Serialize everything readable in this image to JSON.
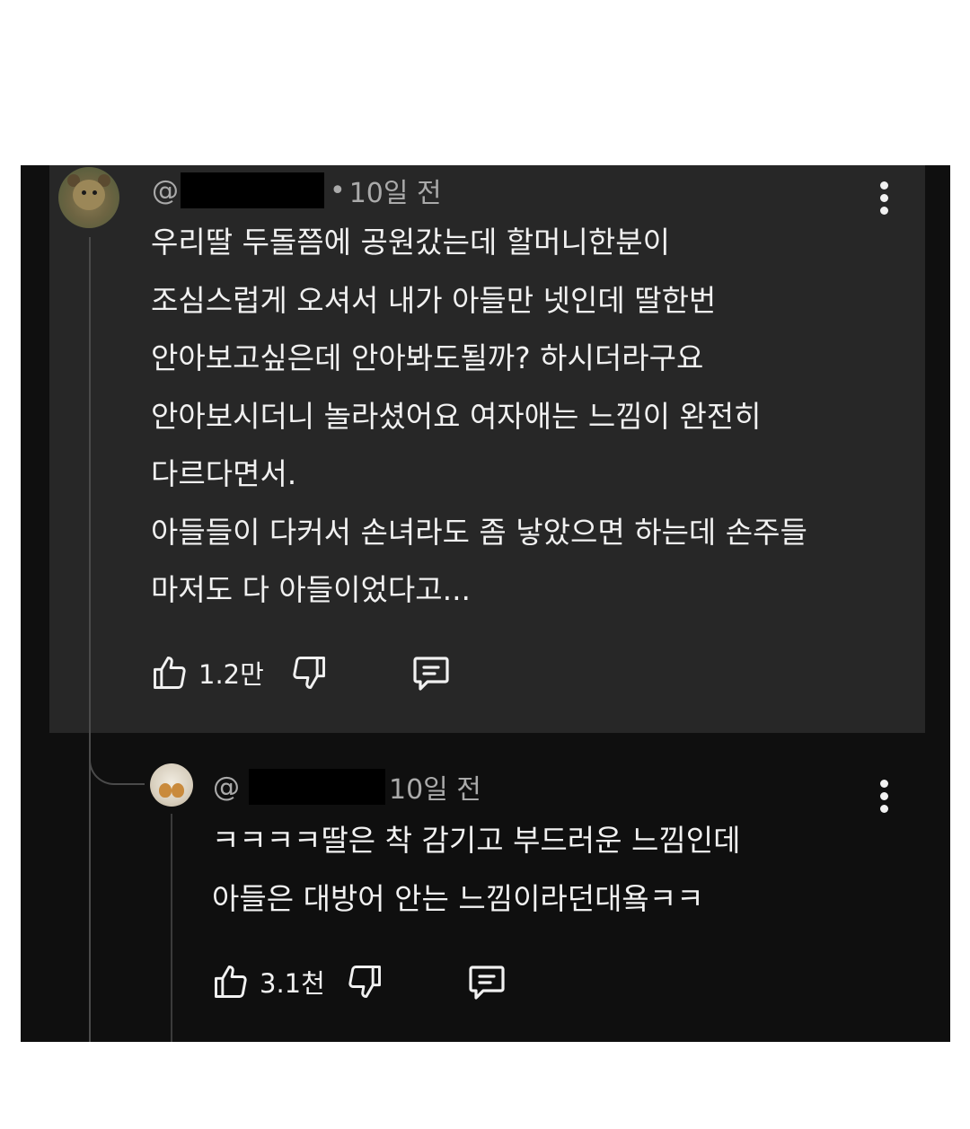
{
  "comments": [
    {
      "handle_prefix": "@",
      "time": "10일 전",
      "text": "우리딸 두돌쯤에 공원갔는데 할머니한분이\n조심스럽게 오셔서 내가 아들만 넷인데 딸한번\n안아보고싶은데 안아봐도될까? 하시더라구요\n안아보시더니 놀라셨어요 여자애는 느낌이 완전히\n다르다면서.\n아들들이 다커서 손녀라도 좀 낳았으면 하는데 손주들\n마저도 다 아들이었다고...",
      "likes": "1.2만",
      "icons": {
        "like": "thumbs-up-icon",
        "dislike": "thumbs-down-icon",
        "reply": "reply-comment-icon",
        "menu": "more-vert-icon"
      }
    },
    {
      "handle_prefix": "@",
      "time": "10일 전",
      "text": "ㅋㅋㅋㅋ딸은 착 감기고 부드러운 느낌인데\n아들은 대방어 안는 느낌이라던대욬ㅋㅋ",
      "likes": "3.1천",
      "icons": {
        "like": "thumbs-up-icon",
        "dislike": "thumbs-down-icon",
        "reply": "reply-comment-icon",
        "menu": "more-vert-icon"
      }
    }
  ],
  "colors": {
    "background": "#0f0f0f",
    "highlighted_comment": "#272727",
    "text": "#f1f1f1",
    "meta_text": "#aaaaaa"
  }
}
